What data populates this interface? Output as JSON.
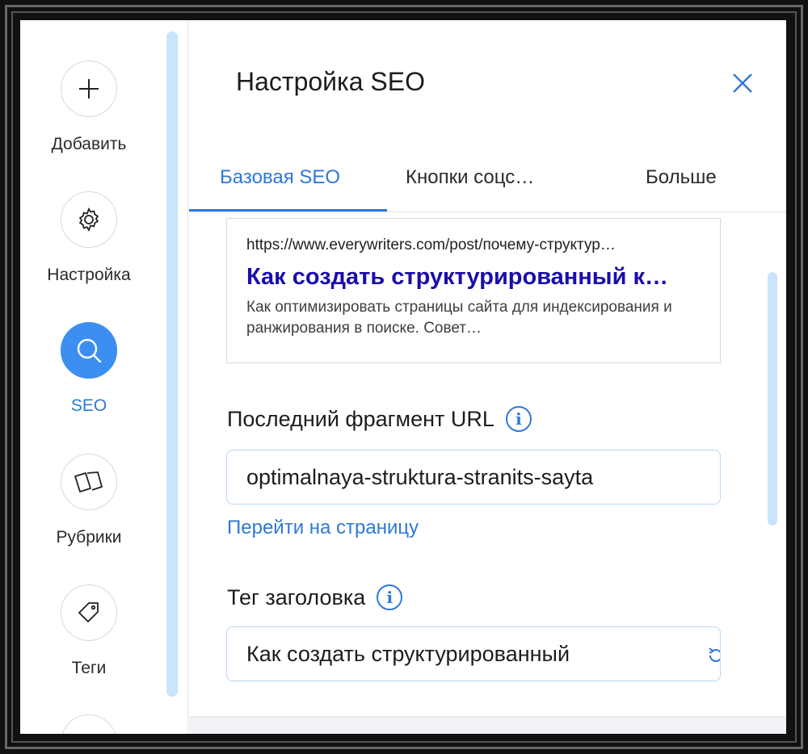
{
  "sidebar": {
    "items": [
      {
        "label": "Добавить",
        "icon": "plus-icon"
      },
      {
        "label": "Настройка",
        "icon": "gear-icon"
      },
      {
        "label": "SEO",
        "icon": "search-icon",
        "active": true
      },
      {
        "label": "Рубрики",
        "icon": "cards-icon"
      },
      {
        "label": "Теги",
        "icon": "tag-icon"
      }
    ]
  },
  "panel": {
    "title": "Настройка SEO",
    "tabs": [
      {
        "label": "Базовая SEO",
        "active": true
      },
      {
        "label": "Кнопки соцс…"
      },
      {
        "label": "Больше"
      }
    ]
  },
  "preview": {
    "url": "https://www.everywriters.com/post/почему-структур…",
    "title": "Как создать структурированный к…",
    "description": "Как оптимизировать страницы сайта для индексирования и ранжирования в поиске. Совет…"
  },
  "url_slug": {
    "label": "Последний фрагмент URL",
    "value": "optimalnaya-struktura-stranits-sayta",
    "link": "Перейти на страницу"
  },
  "title_tag": {
    "label": "Тег заголовка",
    "value": "Как создать структурированный"
  },
  "colors": {
    "accent": "#2f78d8",
    "active_circle": "#3c8ff0",
    "scrollbar": "#c9e4fb",
    "preview_title": "#1a0dab"
  }
}
